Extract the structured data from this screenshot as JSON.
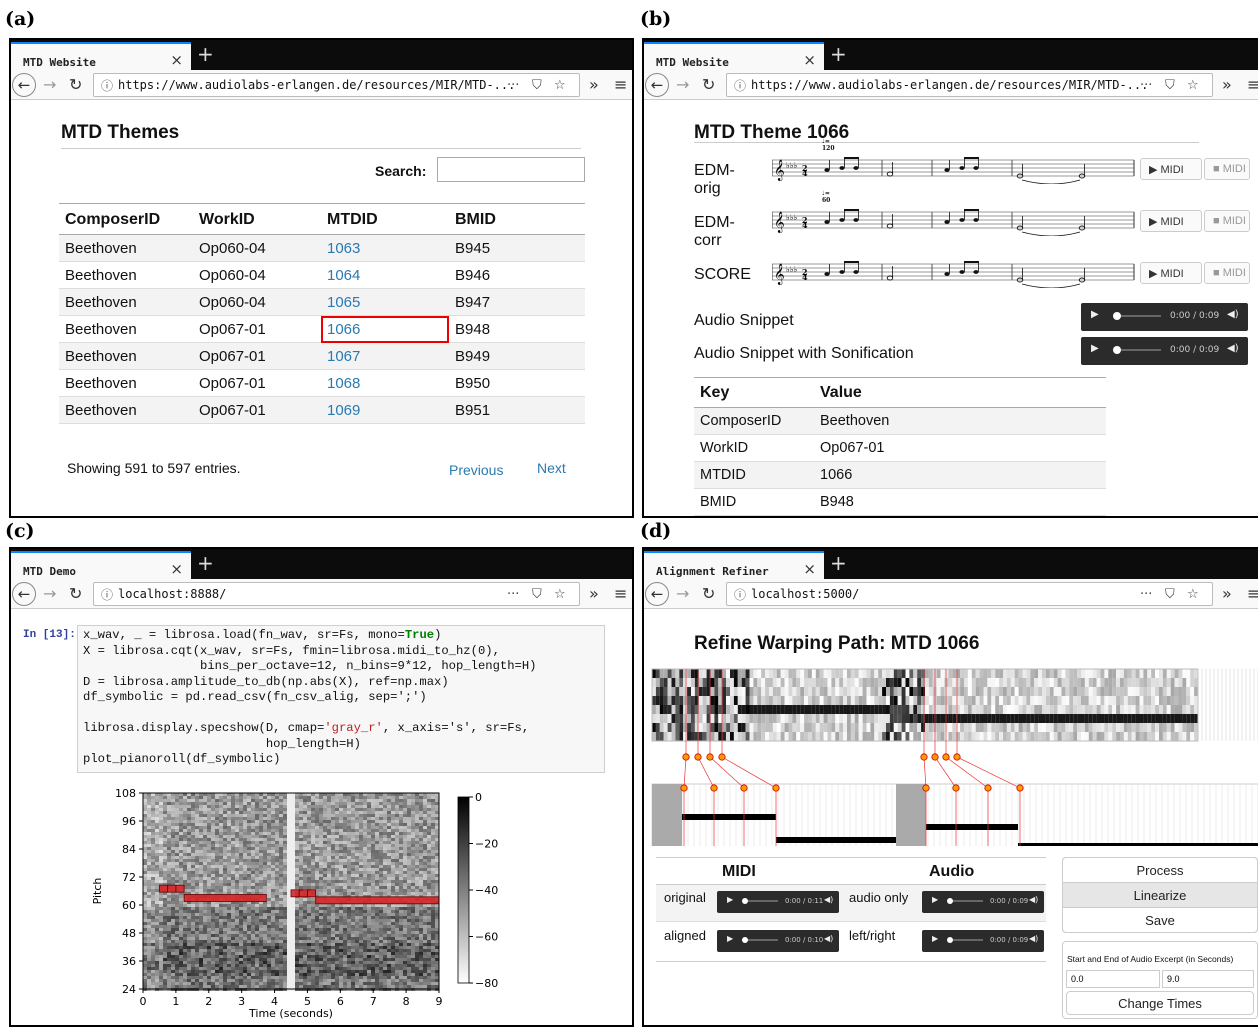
{
  "labels": {
    "a": "(a)",
    "b": "(b)",
    "c": "(c)",
    "d": "(d)"
  },
  "panel_a": {
    "tab_title": "MTD Website",
    "url": "https://www.audiolabs-erlangen.de/resources/MIR/MTD-...",
    "page_title": "MTD Themes",
    "search_label": "Search:",
    "search_value": "",
    "columns": [
      "ComposerID",
      "WorkID",
      "MTDID",
      "BMID"
    ],
    "rows": [
      [
        "Beethoven",
        "Op060-04",
        "1063",
        "B945"
      ],
      [
        "Beethoven",
        "Op060-04",
        "1064",
        "B946"
      ],
      [
        "Beethoven",
        "Op060-04",
        "1065",
        "B947"
      ],
      [
        "Beethoven",
        "Op067-01",
        "1066",
        "B948"
      ],
      [
        "Beethoven",
        "Op067-01",
        "1067",
        "B949"
      ],
      [
        "Beethoven",
        "Op067-01",
        "1068",
        "B950"
      ],
      [
        "Beethoven",
        "Op067-01",
        "1069",
        "B951"
      ]
    ],
    "footer": "Showing 591 to 597 entries.",
    "prev": "Previous",
    "next": "Next"
  },
  "panel_b": {
    "tab_title": "MTD Website",
    "url": "https://www.audiolabs-erlangen.de/resources/MIR/MTD-...",
    "page_title": "MTD Theme 1066",
    "scores": [
      {
        "label": "EDM-orig",
        "tempo": "♩= 120"
      },
      {
        "label": "EDM-corr",
        "tempo": "♩= 60"
      },
      {
        "label": "SCORE",
        "tempo": ""
      }
    ],
    "midi_play": "▶ MIDI",
    "midi_stop": "■ MIDI",
    "audio": [
      {
        "label": "Audio Snippet",
        "time": "0:00 / 0:09"
      },
      {
        "label": "Audio Snippet with Sonification",
        "time": "0:00 / 0:09"
      }
    ],
    "kv_header": [
      "Key",
      "Value"
    ],
    "kv": [
      [
        "ComposerID",
        "Beethoven"
      ],
      [
        "WorkID",
        "Op067-01"
      ],
      [
        "MTDID",
        "1066"
      ],
      [
        "BMID",
        "B948"
      ]
    ]
  },
  "panel_c": {
    "tab_title": "MTD Demo",
    "url": "localhost:8888/",
    "prompt": "In [13]:",
    "code_lines": [
      [
        "x_wav, _ = librosa.load(fn_wav, sr=Fs, mono=",
        "True",
        ")"
      ],
      [
        "X = librosa.cqt(x_wav, sr=Fs, fmin=librosa.midi_to_hz(0),",
        "",
        ""
      ],
      [
        "                bins_per_octave=12, n_bins=9*12, hop_length=H)",
        "",
        ""
      ],
      [
        "D = librosa.amplitude_to_db(np.abs(X), ref=np.max)",
        "",
        ""
      ],
      [
        "df_symbolic = pd.read_csv(fn_csv_alig, sep=';')",
        "",
        ""
      ],
      [
        "",
        "",
        ""
      ],
      [
        "librosa.display.specshow(D, cmap=",
        "'gray_r'",
        ", x_axis='s', sr=Fs,"
      ],
      [
        "                         hop_length=H)",
        "",
        ""
      ],
      [
        "plot_pianoroll(df_symbolic)",
        "",
        ""
      ]
    ],
    "chart_data": {
      "type": "heatmap",
      "xlabel": "Time (seconds)",
      "ylabel": "Pitch",
      "xlim": [
        0,
        9
      ],
      "ylim": [
        24,
        108
      ],
      "xticks": [
        0,
        1,
        2,
        3,
        4,
        5,
        6,
        7,
        8,
        9
      ],
      "yticks": [
        24,
        36,
        48,
        60,
        72,
        84,
        96,
        108
      ],
      "colorbar": {
        "ticks": [
          0,
          -20,
          -40,
          -60,
          -80
        ],
        "labels": [
          "0",
          "−20",
          "−40",
          "−60",
          "−80"
        ],
        "range": [
          -80,
          0
        ],
        "cmap": "gray_r"
      },
      "notes": [
        {
          "start": 0.5,
          "end": 0.75,
          "pitch": 67
        },
        {
          "start": 0.75,
          "end": 1.0,
          "pitch": 67
        },
        {
          "start": 1.0,
          "end": 1.25,
          "pitch": 67
        },
        {
          "start": 1.25,
          "end": 3.75,
          "pitch": 63
        },
        {
          "start": 4.5,
          "end": 4.75,
          "pitch": 65
        },
        {
          "start": 4.75,
          "end": 5.0,
          "pitch": 65
        },
        {
          "start": 5.0,
          "end": 5.25,
          "pitch": 65
        },
        {
          "start": 5.25,
          "end": 9.0,
          "pitch": 62
        }
      ],
      "note_color": "#d62728"
    }
  },
  "panel_d": {
    "tab_title": "Alignment Refiner",
    "url": "localhost:5000/",
    "page_title": "Refine Warping Path: MTD 1066",
    "midi_header": "MIDI",
    "audio_header": "Audio",
    "rows": [
      {
        "l1": "original",
        "t1": "0:00 / 0:11",
        "l2": "audio only",
        "t2": "0:00 / 0:09"
      },
      {
        "l1": "aligned",
        "t1": "0:00 / 0:10",
        "l2": "left/right",
        "t2": "0:00 / 0:09"
      }
    ],
    "buttons": [
      "Process",
      "Linearize",
      "Save"
    ],
    "excerpt_label": "Start and End of Audio Excerpt (in Seconds)",
    "start": "0.0",
    "end": "9.0",
    "change": "Change Times"
  }
}
